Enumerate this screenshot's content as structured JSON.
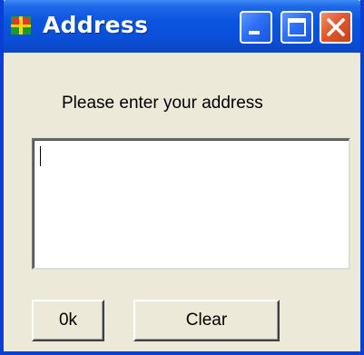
{
  "window": {
    "title": "Address",
    "icon": "app-icon",
    "controls": {
      "minimize_icon": "minimize-icon",
      "maximize_icon": "maximize-icon",
      "close_icon": "close-icon"
    }
  },
  "form": {
    "prompt": "Please enter your address",
    "address_value": ""
  },
  "buttons": {
    "ok_label": "0k",
    "clear_label": "Clear"
  },
  "colors": {
    "titlebar": "#0a4fd6",
    "window_background": "#ece9d8",
    "close_button": "#e0582e"
  }
}
